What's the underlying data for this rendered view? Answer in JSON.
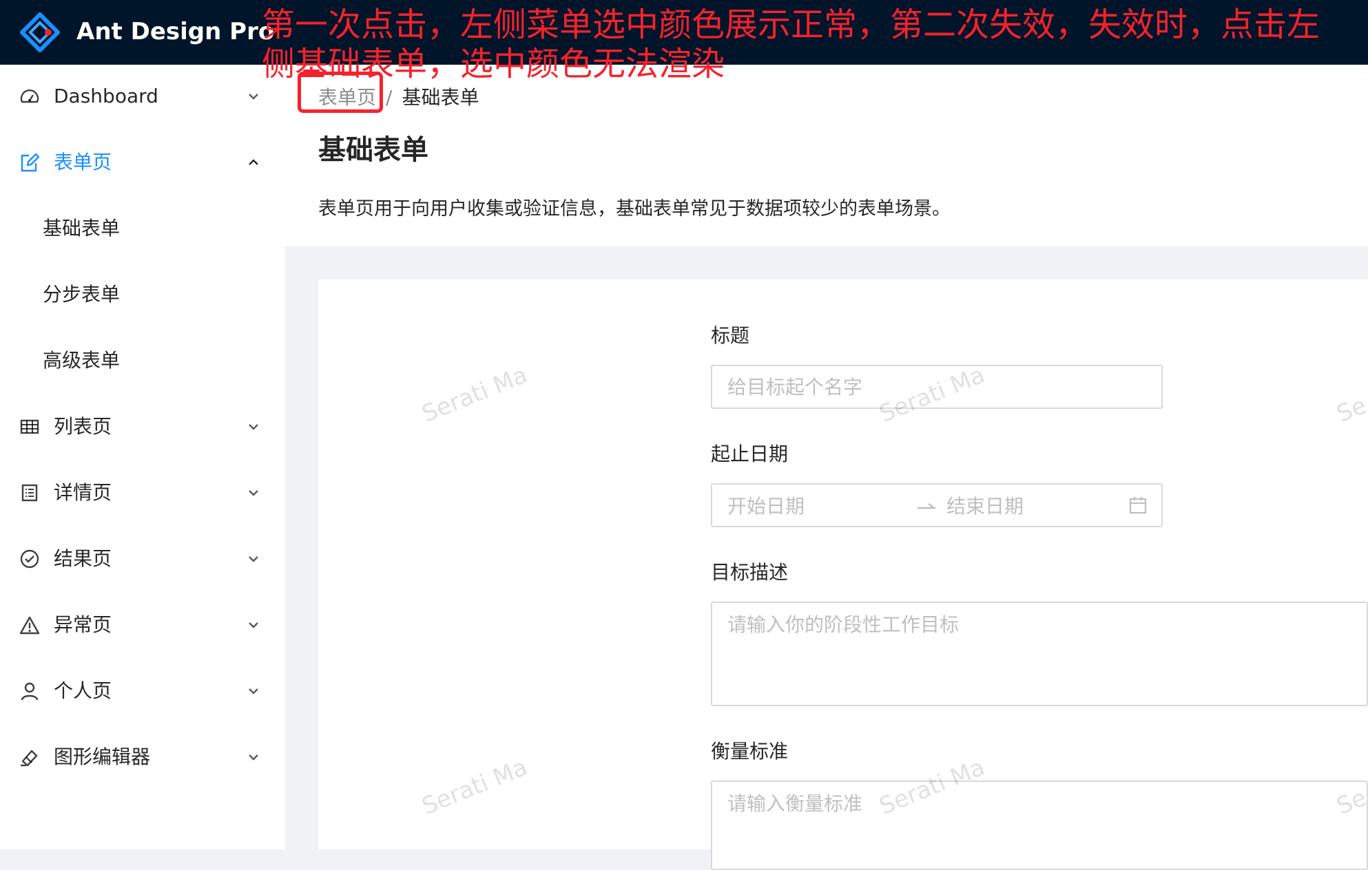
{
  "header": {
    "app_title": "Ant Design Pro",
    "annotation": "第一次点击，左侧菜单选中颜色展示正常，第二次失效，失效时，点击左侧基础表单，选中颜色无法渲染"
  },
  "colors": {
    "header_bg": "#001529",
    "primary": "#1890ff",
    "annotation": "#f5222d",
    "content_bg": "#f0f2f5"
  },
  "sidebar": {
    "items": [
      {
        "label": "Dashboard",
        "icon": "dashboard-icon",
        "expanded": false
      },
      {
        "label": "表单页",
        "icon": "form-edit-icon",
        "expanded": true,
        "children": [
          "基础表单",
          "分步表单",
          "高级表单"
        ]
      },
      {
        "label": "列表页",
        "icon": "table-icon",
        "expanded": false
      },
      {
        "label": "详情页",
        "icon": "profile-icon",
        "expanded": false
      },
      {
        "label": "结果页",
        "icon": "check-circle-icon",
        "expanded": false
      },
      {
        "label": "异常页",
        "icon": "warning-icon",
        "expanded": false
      },
      {
        "label": "个人页",
        "icon": "user-icon",
        "expanded": false
      },
      {
        "label": "图形编辑器",
        "icon": "highlight-icon",
        "expanded": false
      }
    ]
  },
  "breadcrumb": {
    "parent": "表单页",
    "separator": "/",
    "current": "基础表单"
  },
  "page": {
    "title": "基础表单",
    "description": "表单页用于向用户收集或验证信息，基础表单常见于数据项较少的表单场景。"
  },
  "form": {
    "title_label": "标题",
    "title_placeholder": "给目标起个名字",
    "date_label": "起止日期",
    "date_start_placeholder": "开始日期",
    "date_end_placeholder": "结束日期",
    "goal_label": "目标描述",
    "goal_placeholder": "请输入你的阶段性工作目标",
    "standard_label": "衡量标准",
    "standard_placeholder": "请输入衡量标准"
  },
  "watermark": "Serati Ma",
  "watermark_clipped": "Se"
}
